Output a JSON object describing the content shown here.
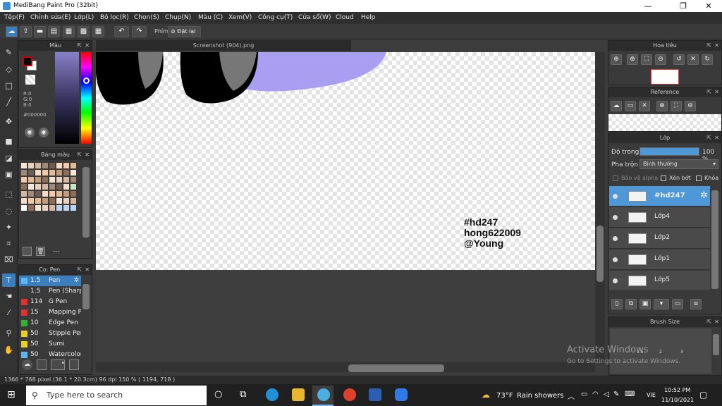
{
  "window": {
    "title": "MediBang Paint Pro (32bit)",
    "min": "—",
    "max": "❐",
    "close": "✕"
  },
  "menu": [
    "Tệp(F)",
    "Chỉnh sửa(E)",
    "Lớp(L)",
    "Bộ lọc(R)",
    "Chọn(S)",
    "Chụp(N)",
    "Màu (C)",
    "Xem(V)",
    "Công cụ(T)",
    "Cửa sổ(W)",
    "Cloud",
    "Help"
  ],
  "toolbar": {
    "phim_label": "Phím",
    "reset_label": "Đặt lại"
  },
  "color_panel": {
    "title": "Màu",
    "r": "R:0",
    "g": "G:0",
    "b": "B:0",
    "hex": "#000000",
    "fg": "#000000",
    "bg": "#ffffff"
  },
  "palette_panel": {
    "title": "Bảng màu",
    "footer": "---"
  },
  "brush_panel": {
    "title": "Cọ: Pen",
    "items": [
      {
        "size": "1.5",
        "name": "Pen",
        "color": "#5bb8ef"
      },
      {
        "size": "1.5",
        "name": "Pen (Sharp)",
        "color": "#3a3a3a"
      },
      {
        "size": "114",
        "name": "G Pen",
        "color": "#e03030"
      },
      {
        "size": "15",
        "name": "Mapping Pen",
        "color": "#e03030"
      },
      {
        "size": "10",
        "name": "Edge Pen",
        "color": "#2db52d"
      },
      {
        "size": "50",
        "name": "Stipple Pen",
        "color": "#e8d020"
      },
      {
        "size": "50",
        "name": "Sumi",
        "color": "#e8d020"
      },
      {
        "size": "50",
        "name": "Watercolor",
        "color": "#5bb8ef"
      }
    ]
  },
  "canvas": {
    "tab_title": "Screenshot (904).png",
    "text_lines": [
      "#hd247",
      "hong622009",
      "@Young"
    ]
  },
  "navigator": {
    "title": "Hoa tiêu"
  },
  "reference": {
    "title": "Reference"
  },
  "layers": {
    "title": "Lớp",
    "opacity_label": "Độ trong",
    "opacity_value": "100 %",
    "blend_label": "Pha trộn",
    "blend_value": "Bình thường",
    "protect_alpha": "Bảo vệ alpha",
    "clip": "Xén bớt",
    "lock": "Khóa",
    "items": [
      {
        "name": "#hd247"
      },
      {
        "name": "Lớp4"
      },
      {
        "name": "Lớp2"
      },
      {
        "name": "Lớp1"
      },
      {
        "name": "Lớp5"
      }
    ]
  },
  "brush_size": {
    "title": "Brush Size",
    "labels": [
      "1.5",
      "2",
      "3"
    ]
  },
  "status": {
    "text": "1366 * 768 pixel   (36.1 * 20.3cm)   96 dpi   150 %   ( 1194, 718 )"
  },
  "watermark": {
    "line1": "Activate Windows",
    "line2": "Go to Settings to activate Windows."
  },
  "taskbar": {
    "search_placeholder": "Type here to search",
    "weather_temp": "73°F",
    "weather_text": "Rain showers",
    "lang": "VIE",
    "time": "10:52 PM",
    "date": "11/10/2021"
  }
}
